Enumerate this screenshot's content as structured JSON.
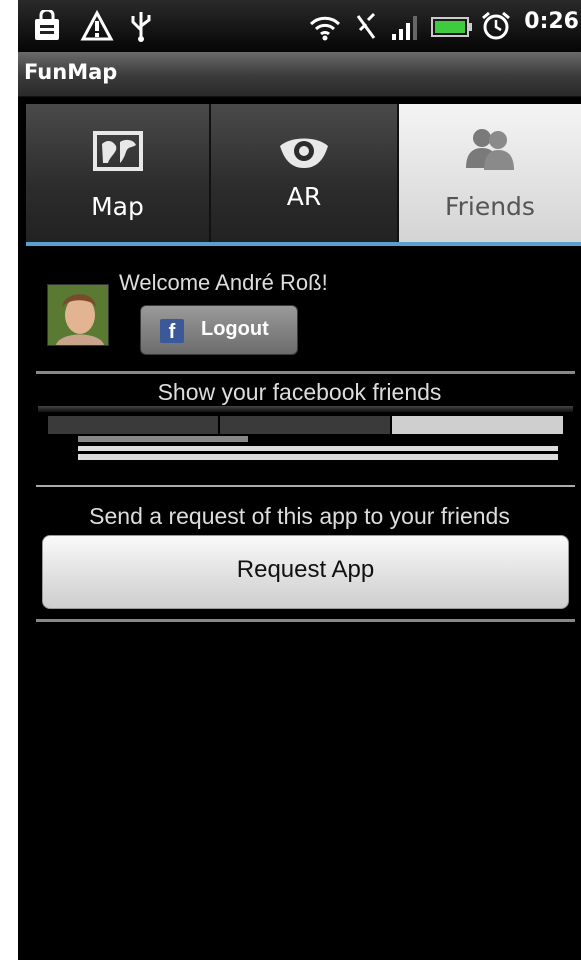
{
  "status_bar": {
    "time": "0:26",
    "icons": [
      "shopping-bag-icon",
      "warning-icon",
      "usb-icon",
      "wifi-icon",
      "no-sync-icon",
      "signal-icon",
      "battery-icon",
      "alarm-icon"
    ]
  },
  "app": {
    "title": "FunMap"
  },
  "tabs": [
    {
      "label": "Map",
      "icon": "map-icon",
      "selected": false
    },
    {
      "label": "AR",
      "icon": "eye-icon",
      "selected": false
    },
    {
      "label": "Friends",
      "icon": "friends-icon",
      "selected": true
    }
  ],
  "profile": {
    "welcome": "Welcome André Roß!",
    "logout_label": "Logout",
    "facebook_glyph": "f"
  },
  "friends_section": {
    "label": "Show your facebook friends"
  },
  "request_section": {
    "label": "Send a request of this app to your friends",
    "button_label": "Request App"
  },
  "colors": {
    "accent": "#5aa0cf",
    "facebook": "#3b5998"
  }
}
